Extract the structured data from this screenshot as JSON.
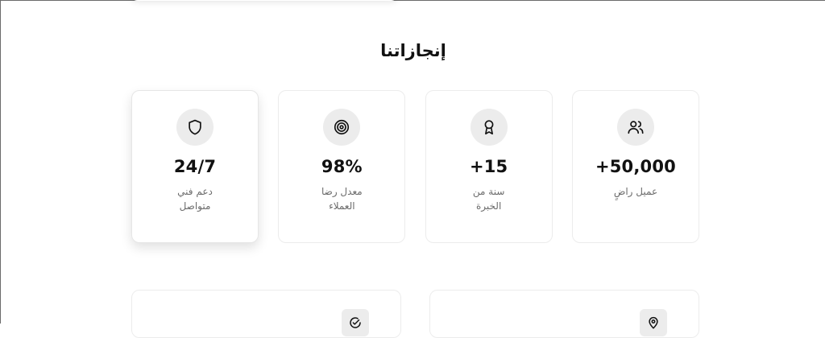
{
  "section": {
    "title": "إنجازاتنا"
  },
  "stats": [
    {
      "icon": "users-icon",
      "value": "+50,000",
      "label": "عميل راضٍ"
    },
    {
      "icon": "award-icon",
      "value": "+15",
      "label": "سنة من الخبرة"
    },
    {
      "icon": "target-icon",
      "value": "98%",
      "label": "معدل رضا العملاء"
    },
    {
      "icon": "shield-icon",
      "value": "24/7",
      "label": "دعم فني متواصل"
    }
  ],
  "bottom_cards": [
    {
      "icon": "check-badge-icon"
    },
    {
      "icon": "location-pin-icon"
    }
  ],
  "colors": {
    "icon_bg": "#ececec",
    "card_border": "#ececec",
    "label_text": "#6b6b6b",
    "value_text": "#111111"
  }
}
